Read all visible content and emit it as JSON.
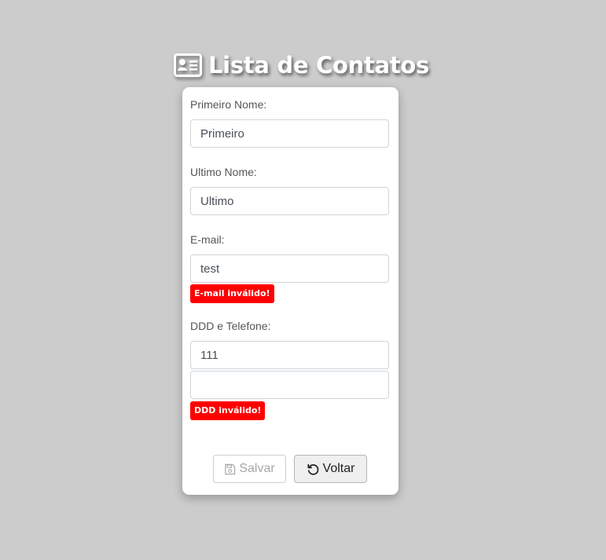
{
  "header": {
    "title": "Lista de Contatos",
    "icon": "contact-card-icon"
  },
  "form": {
    "first_name": {
      "label": "Primeiro Nome:",
      "value": "Primeiro"
    },
    "last_name": {
      "label": "Ultimo Nome:",
      "value": "Ultimo"
    },
    "email": {
      "label": "E-mail:",
      "value": "test",
      "error": "E-mail inválido!"
    },
    "phone": {
      "label": "DDD e Telefone:",
      "ddd_value": "111",
      "number_value": "",
      "error": "DDD inválido!"
    }
  },
  "buttons": {
    "save": {
      "label": "Salvar",
      "icon": "floppy-disk-icon",
      "disabled": true
    },
    "back": {
      "label": "Voltar",
      "icon": "undo-arrow-icon"
    }
  },
  "colors": {
    "background": "#cccccc",
    "card": "#ffffff",
    "error": "#ff0000",
    "title": "#ffffff"
  }
}
